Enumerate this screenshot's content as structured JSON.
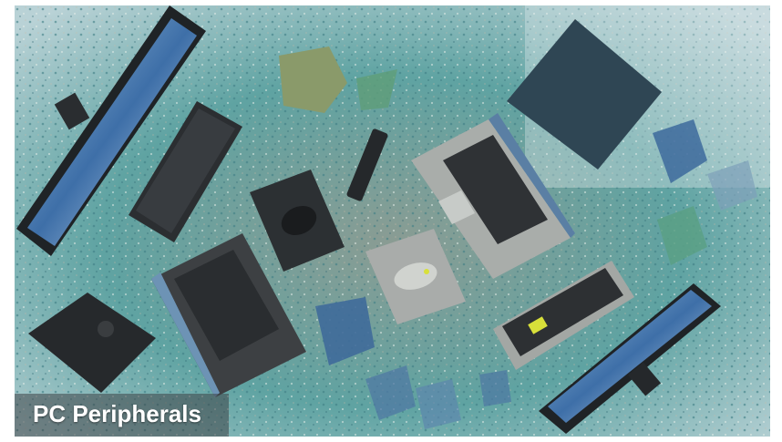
{
  "caption": {
    "text": "PC Peripherals"
  },
  "colors": {
    "background_terrazzo": "#6fa7a4",
    "device_dark": "#2e3134",
    "device_grey": "#a9adaa",
    "accent_yellow": "#d8e03a"
  }
}
